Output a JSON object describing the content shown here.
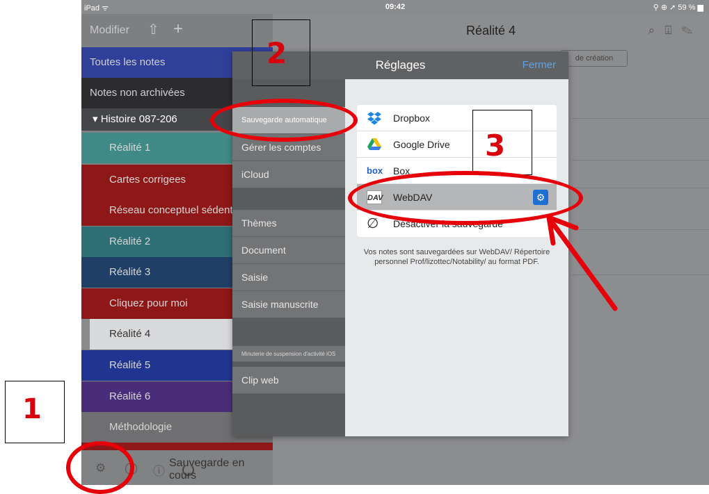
{
  "status_bar": {
    "device": "iPad ᯤ",
    "time": "09:42",
    "battery": "⚲ ⊕ ➚ 59 % ▆"
  },
  "sidebar": {
    "toolbar": {
      "edit_label": "Modifier",
      "share_glyph": "⇧",
      "add_glyph": "+"
    },
    "top_items": [
      {
        "label": "Toutes les notes",
        "color": "#2f3f9a"
      },
      {
        "label": "Notes non archivées",
        "color": "#2c2c2e"
      }
    ],
    "section": {
      "label": "▾  Histoire 087-206",
      "color": "#444548"
    },
    "notes": [
      {
        "label": "Réalité 1",
        "color": "#3f8a86"
      },
      {
        "label": "Cartes corrigees",
        "color": "#8e1717"
      },
      {
        "label": "Réseau conceptuel sédentarité",
        "color": "#8e1717"
      },
      {
        "label": "Réalité 2",
        "color": "#2e6e75"
      },
      {
        "label": "Réalité 3",
        "color": "#1f3f66"
      },
      {
        "label": "Cliquez pour moi",
        "color": "#8e1717"
      },
      {
        "label": "Réalité 4",
        "color": "#d8d9db",
        "selected": true
      },
      {
        "label": "Réalité 5",
        "color": "#20358f"
      },
      {
        "label": "Réalité 6",
        "color": "#4a2d7a"
      },
      {
        "label": "Méthodologie",
        "color": "#6f6f71"
      }
    ],
    "bottom": {
      "saving_label": "Sauvegarde en cours"
    }
  },
  "main": {
    "title": "Réalité 4",
    "sort_label": "de création"
  },
  "dialog": {
    "title": "Réglages",
    "close_label": "Fermer",
    "left_items": [
      {
        "label": "Sauvegarde automatique",
        "active": true
      },
      {
        "label": "Gérer les comptes"
      },
      {
        "label": "iCloud"
      },
      {
        "label": "Thèmes"
      },
      {
        "label": "Document"
      },
      {
        "label": "Saisie"
      },
      {
        "label": "Saisie manuscrite"
      },
      {
        "label": "Minuterie de suspension d'activité iOS"
      },
      {
        "label": "Clip web"
      }
    ],
    "options": [
      {
        "label": "Dropbox",
        "icon": "dropbox-icon"
      },
      {
        "label": "Google Drive",
        "icon": "google-drive-icon"
      },
      {
        "label": "Box",
        "icon": "box-icon",
        "glyph": "box"
      },
      {
        "label": "WebDAV",
        "icon": "webdav-icon",
        "glyph": "DAV",
        "selected": true
      },
      {
        "label": "Désactiver la sauvegarde",
        "icon": "disable-icon",
        "glyph": "∅"
      }
    ],
    "note": "Vos notes sont sauvegardées sur WebDAV/ Répertoire personnel Prof/lizottec/Notability/ au format PDF."
  },
  "annotations": {
    "step1": "1",
    "step2": "2",
    "step3": "3",
    "color": "#e6000a"
  }
}
